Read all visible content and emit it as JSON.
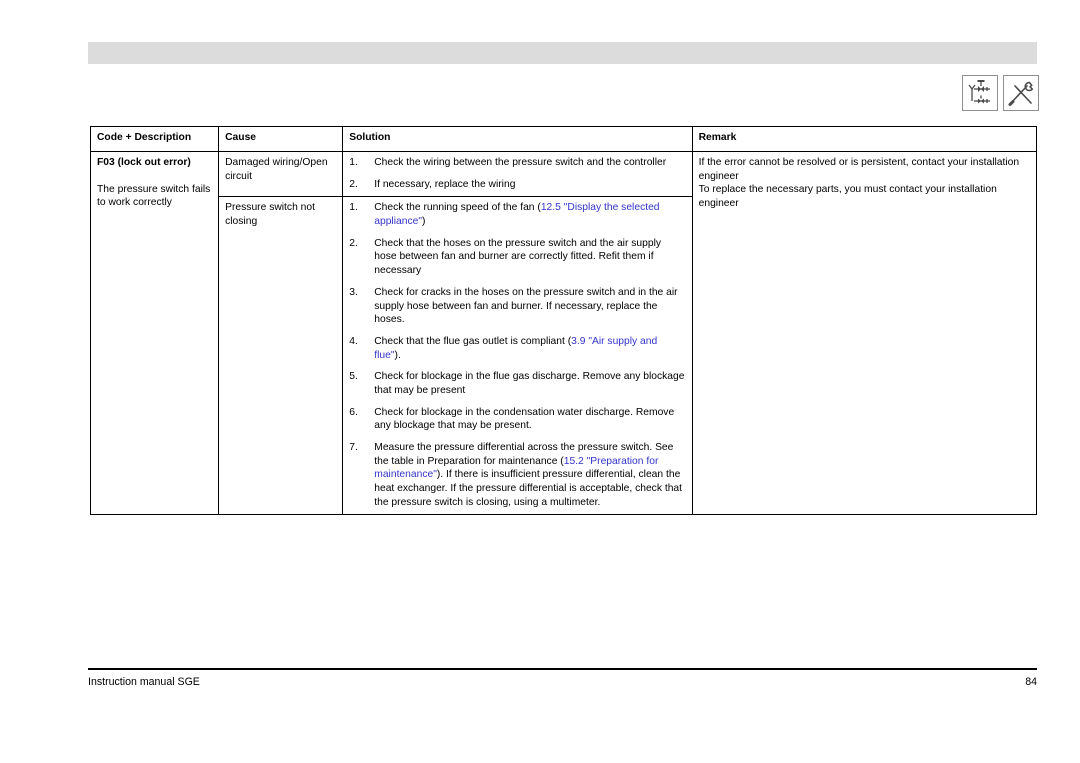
{
  "document": {
    "header_band": "",
    "icons": [
      {
        "name": "gas-valve-train-icon",
        "title": "Gas / hydraulic schematic symbol"
      },
      {
        "name": "crossed-tools-icon",
        "title": "Service tools (wrench and screwdriver)"
      }
    ],
    "footer": {
      "left": "Instruction manual SGE",
      "page_number": "84"
    }
  },
  "table": {
    "headers": [
      "Code + Description",
      "Cause",
      "Solution",
      "Remark"
    ],
    "code": {
      "title": "F03 (lock out error)",
      "description": "The pressure switch fails to work correctly"
    },
    "remark": {
      "line1": "If the error cannot be resolved or is persistent, contact your installation engineer",
      "line2": "To replace the necessary parts, you must contact your installation engineer"
    },
    "rows": [
      {
        "cause": "Damaged wiring/Open circuit",
        "steps": [
          {
            "num": "1.",
            "parts": [
              {
                "text": "Check the wiring between the pressure switch and the controller",
                "link": false
              }
            ]
          },
          {
            "num": "2.",
            "parts": [
              {
                "text": "If necessary, replace the wiring",
                "link": false
              }
            ]
          }
        ]
      },
      {
        "cause": "Pressure switch not closing",
        "steps": [
          {
            "num": "1.",
            "parts": [
              {
                "text": "Check the running speed of the fan (",
                "link": false
              },
              {
                "text": "12.5 \"Display the selected appliance\"",
                "link": true
              },
              {
                "text": ")",
                "link": false
              }
            ]
          },
          {
            "num": "2.",
            "parts": [
              {
                "text": "Check that the hoses on the pressure switch and the air supply hose between fan and burner are correctly fitted. Refit them if necessary",
                "link": false
              }
            ]
          },
          {
            "num": "3.",
            "parts": [
              {
                "text": "Check for cracks in the hoses on the pressure switch and in the air supply hose between fan and burner. If necessary, replace the hoses.",
                "link": false
              }
            ]
          },
          {
            "num": "4.",
            "parts": [
              {
                "text": "Check that the flue gas outlet is compliant (",
                "link": false
              },
              {
                "text": "3.9 \"Air supply and flue\"",
                "link": true
              },
              {
                "text": ").",
                "link": false
              }
            ]
          },
          {
            "num": "5.",
            "parts": [
              {
                "text": "Check for blockage in the flue gas discharge. Remove any blockage that may be present",
                "link": false
              }
            ]
          },
          {
            "num": "6.",
            "parts": [
              {
                "text": "Check for blockage in the condensation water discharge. Remove any blockage that may be present.",
                "link": false
              }
            ]
          },
          {
            "num": "7.",
            "parts": [
              {
                "text": "Measure the pressure differential across the pressure switch. See the table in Preparation for maintenance (",
                "link": false
              },
              {
                "text": "15.2 \"Preparation for maintenance\"",
                "link": true
              },
              {
                "text": "). If there is insufficient pressure differential, clean the heat exchanger. If the pressure differential is acceptable, check that the pressure switch is closing, using a multimeter.",
                "link": false
              }
            ]
          }
        ]
      }
    ]
  }
}
